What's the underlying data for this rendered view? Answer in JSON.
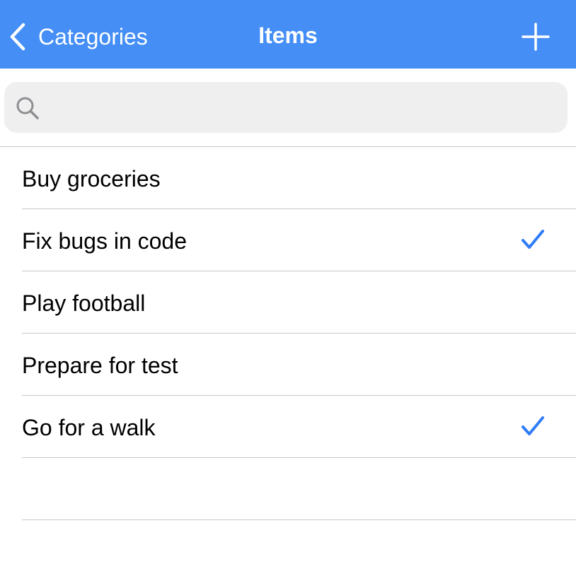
{
  "navbar": {
    "back_label": "Categories",
    "title": "Items",
    "back_icon": "chevron-left-icon",
    "add_icon": "plus-icon",
    "background": "#448ef6"
  },
  "search": {
    "placeholder": "",
    "value": "",
    "icon": "search-icon"
  },
  "items": [
    {
      "label": "Buy groceries",
      "checked": false
    },
    {
      "label": "Fix bugs in code",
      "checked": true
    },
    {
      "label": "Play football",
      "checked": false
    },
    {
      "label": "Prepare for test",
      "checked": false
    },
    {
      "label": "Go for a walk",
      "checked": true
    },
    {
      "label": "",
      "checked": false
    }
  ],
  "colors": {
    "accent": "#448ef6",
    "checkmark": "#2f7cf6",
    "separator": "#c8c8cc",
    "search_bg": "#efefef"
  }
}
